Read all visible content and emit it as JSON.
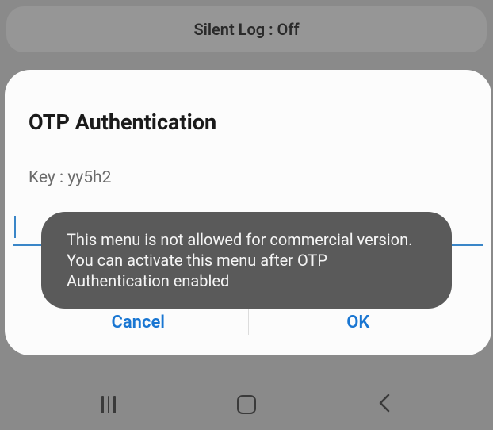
{
  "header": {
    "silent_log_label": "Silent Log : Off"
  },
  "dialog": {
    "title": "OTP Authentication",
    "key_label": "Key : yy5h2",
    "input_value": "",
    "cancel_label": "Cancel",
    "ok_label": "OK"
  },
  "toast": {
    "message": "This menu is not allowed for commercial version. You can activate this menu after OTP Authentication enabled"
  },
  "navbar": {
    "recents_name": "recents",
    "home_name": "home",
    "back_name": "back"
  }
}
